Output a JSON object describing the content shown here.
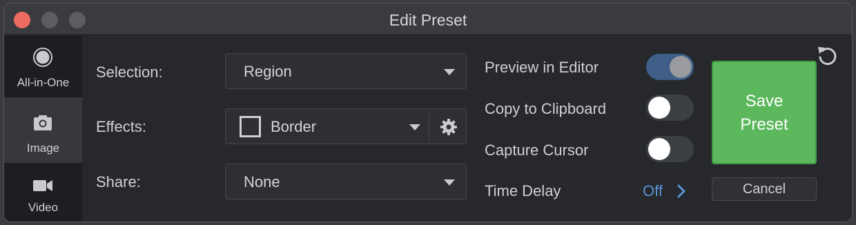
{
  "window": {
    "title": "Edit Preset"
  },
  "sidebar": {
    "items": [
      {
        "label": "All-in-One",
        "icon": "record-icon"
      },
      {
        "label": "Image",
        "icon": "camera-icon"
      },
      {
        "label": "Video",
        "icon": "video-camera-icon"
      }
    ]
  },
  "form": {
    "selection": {
      "label": "Selection:",
      "value": "Region"
    },
    "effects": {
      "label": "Effects:",
      "value": "Border"
    },
    "share": {
      "label": "Share:",
      "value": "None"
    }
  },
  "options": {
    "preview_in_editor": {
      "label": "Preview in Editor",
      "on": true
    },
    "copy_to_clipboard": {
      "label": "Copy to Clipboard",
      "on": false
    },
    "capture_cursor": {
      "label": "Capture Cursor",
      "on": false
    },
    "time_delay": {
      "label": "Time Delay",
      "value": "Off"
    }
  },
  "actions": {
    "save_label_line1": "Save",
    "save_label_line2": "Preset",
    "cancel_label": "Cancel"
  },
  "colors": {
    "save": "#5cb85c",
    "toggle_on": "#3f5e88",
    "link": "#5b94d6",
    "close": "#ed6a5e"
  }
}
